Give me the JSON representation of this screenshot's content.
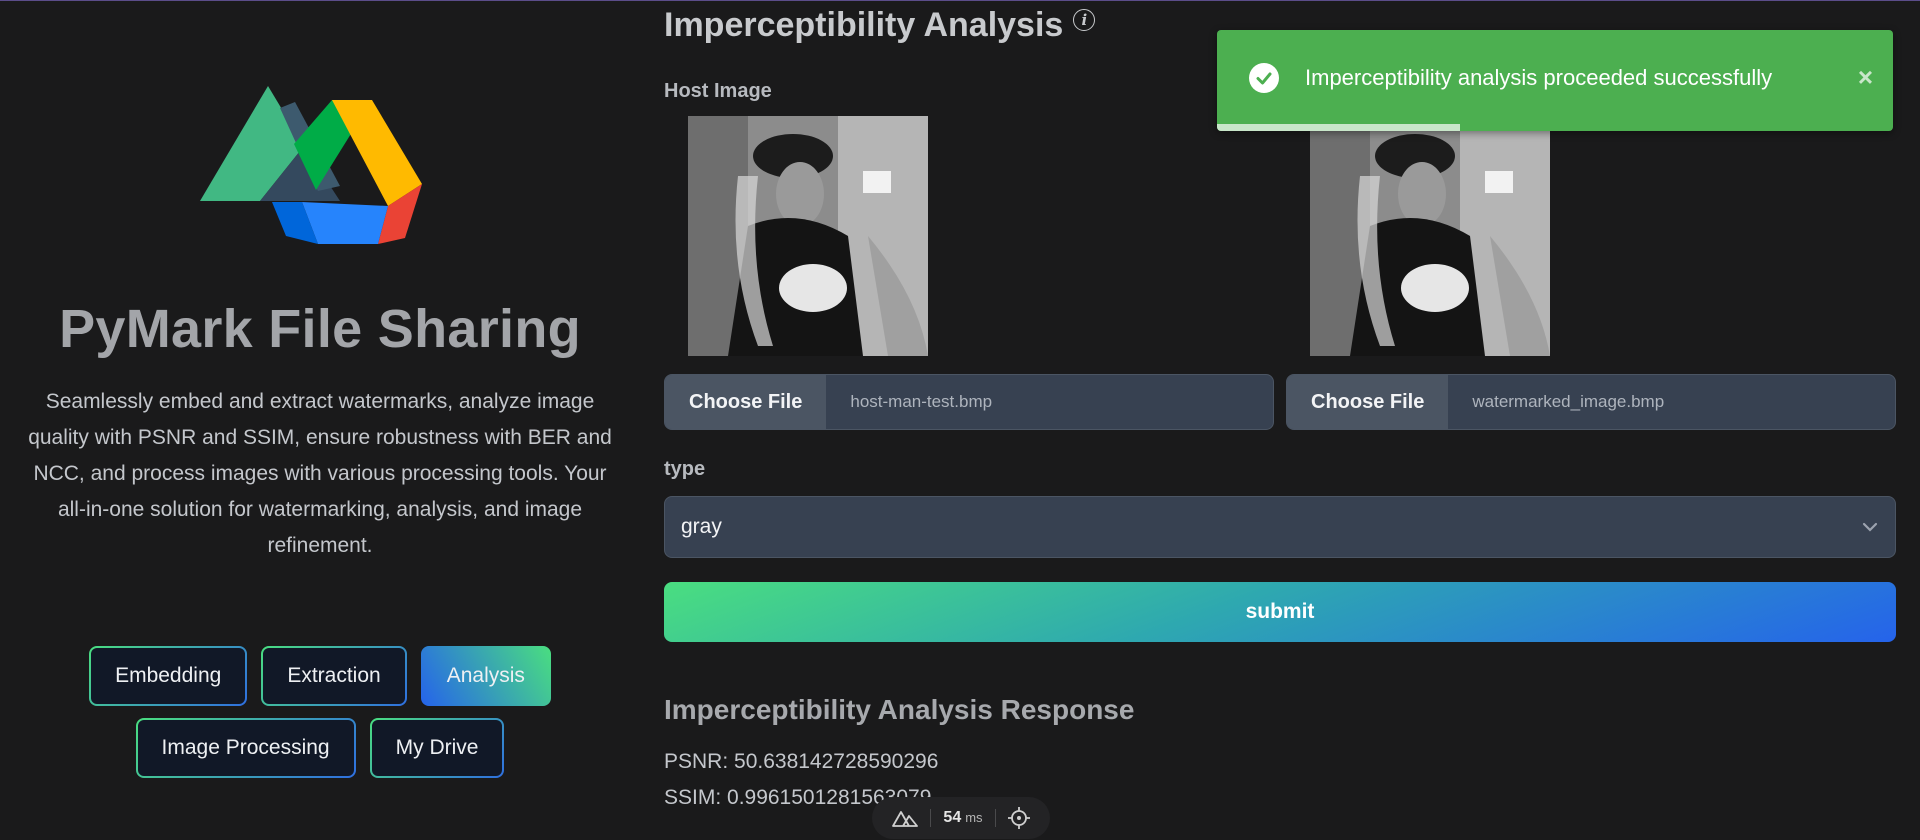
{
  "app": {
    "title": "PyMark File Sharing",
    "description": "Seamlessly embed and extract watermarks, analyze image quality with PSNR and SSIM, ensure robustness with BER and NCC, and process images with various processing tools. Your all-in-one solution for watermarking, analysis, and image refinement."
  },
  "nav": [
    {
      "label": "Embedding",
      "active": false
    },
    {
      "label": "Extraction",
      "active": false
    },
    {
      "label": "Analysis",
      "active": true
    },
    {
      "label": "Image Processing",
      "active": false
    },
    {
      "label": "My Drive",
      "active": false
    }
  ],
  "page": {
    "title": "Imperceptibility Analysis",
    "host_label": "Host Image"
  },
  "files": {
    "choose_label": "Choose File",
    "host_file": "host-man-test.bmp",
    "watermarked_file": "watermarked_image.bmp"
  },
  "type_field": {
    "label": "type",
    "value": "gray"
  },
  "submit_label": "submit",
  "response": {
    "title": "Imperceptibility Analysis Response",
    "psnr": "PSNR: 50.638142728590296",
    "ssim": "SSIM: 0.9961501281563079"
  },
  "toast": {
    "message": "Imperceptibility analysis proceeded successfully",
    "close": "×",
    "progress": 0.36
  },
  "devtools": {
    "ms_value": "54",
    "ms_unit": "ms"
  },
  "colors": {
    "toast": "#4caf50",
    "accent_green": "#4ade80",
    "accent_blue": "#2563eb",
    "background": "#1a1a1b"
  },
  "icons": [
    "vue-drive-logo",
    "info-icon",
    "check-icon",
    "close-icon",
    "chevron-down-icon",
    "nuxt-icon",
    "crosshair-icon"
  ]
}
